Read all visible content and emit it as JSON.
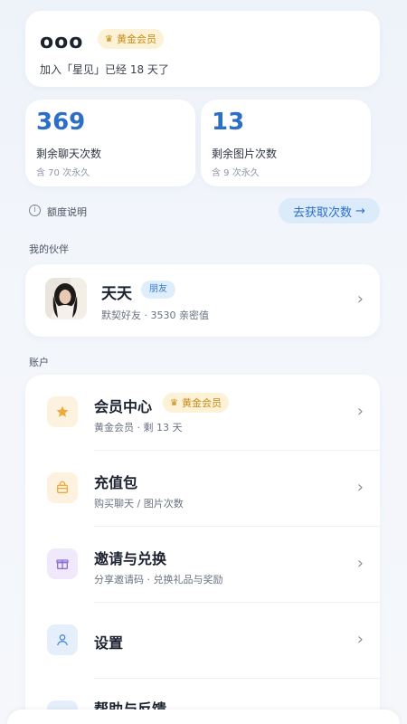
{
  "profile": {
    "name": "ooo",
    "badge": "黄金会员",
    "joined": "加入「星见」已经 18 天了"
  },
  "stats": [
    {
      "value": "369",
      "label": "剩余聊天次数",
      "sub": "含 70 次永久"
    },
    {
      "value": "13",
      "label": "剩余图片次数",
      "sub": "含 9 次永久"
    }
  ],
  "quota": {
    "info": "额度说明",
    "get_button": "去获取次数",
    "arrow": "→"
  },
  "sections": {
    "partner": "我的伙伴",
    "account": "账户"
  },
  "partner": {
    "name": "天天",
    "tag": "朋友",
    "sub": "默契好友 · 3530 亲密值"
  },
  "account_items": [
    {
      "title": "会员中心",
      "badge": "黄金会员",
      "sub": "黄金会员 · 剩 13 天",
      "icon": "star-icon",
      "color": "#f0a93b",
      "bg": "#fdf2df"
    },
    {
      "title": "充值包",
      "sub": "购买聊天 / 图片次数",
      "icon": "bag-icon",
      "color": "#f0a93b",
      "bg": "#fdf2df"
    },
    {
      "title": "邀请与兑换",
      "sub": "分享邀请码 · 兑换礼品与奖励",
      "icon": "gift-icon",
      "color": "#8a6fd6",
      "bg": "#efe9fb"
    },
    {
      "title": "设置",
      "sub": "",
      "icon": "user-icon",
      "color": "#4a8ad4",
      "bg": "#e4effb"
    },
    {
      "title": "帮助与反馈",
      "sub": "",
      "icon": "help-icon",
      "color": "#4a8ad4",
      "bg": "#e4effb"
    }
  ]
}
